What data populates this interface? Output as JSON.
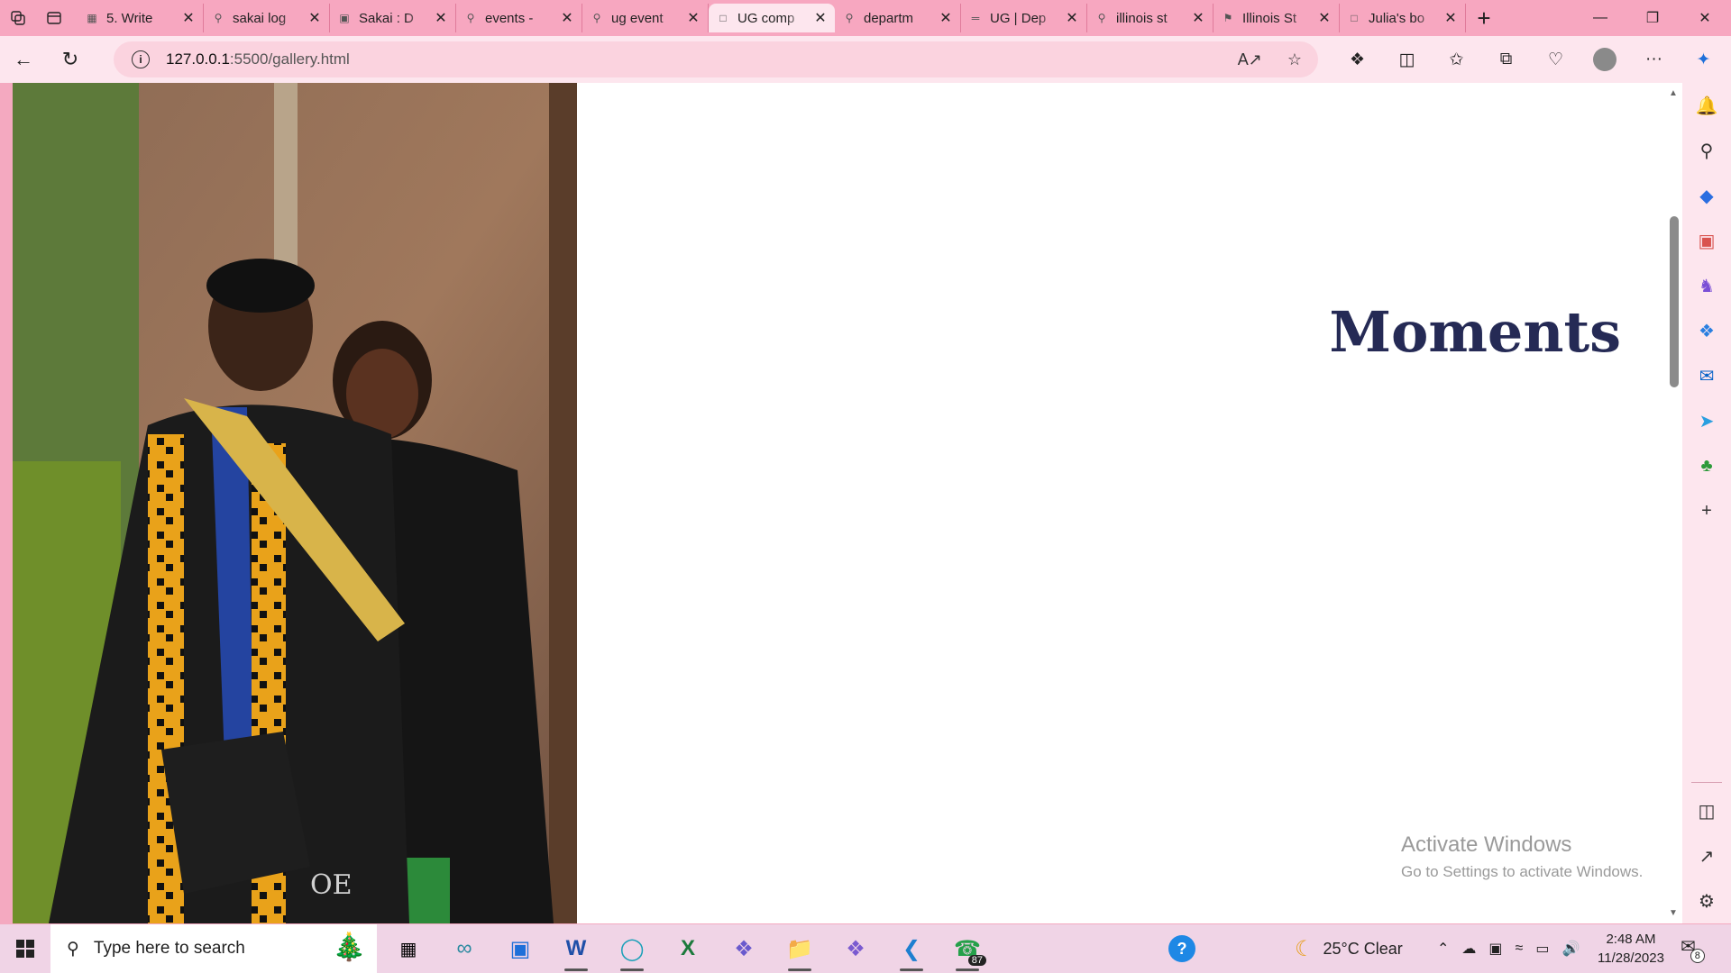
{
  "tabs": [
    {
      "title": "5. Write",
      "icon": "document-icon"
    },
    {
      "title": "sakai log",
      "icon": "search-icon"
    },
    {
      "title": "Sakai : D",
      "icon": "sakai-icon"
    },
    {
      "title": "events -",
      "icon": "search-icon"
    },
    {
      "title": "ug event",
      "icon": "search-icon"
    },
    {
      "title": "UG comp",
      "icon": "page-icon",
      "active": true
    },
    {
      "title": "departm",
      "icon": "search-icon"
    },
    {
      "title": "UG | Dep",
      "icon": "ug-icon"
    },
    {
      "title": "illinois st",
      "icon": "search-icon"
    },
    {
      "title": "Illinois St",
      "icon": "illinois-icon"
    },
    {
      "title": "Julia's bo",
      "icon": "page-icon"
    }
  ],
  "address": {
    "host": "127.0.0.1",
    "path": ":5500/gallery.html"
  },
  "page": {
    "heading": "Moments"
  },
  "watermark": {
    "line1": "Activate Windows",
    "line2": "Go to Settings to activate Windows."
  },
  "taskbar": {
    "search_placeholder": "Type here to search",
    "whatsapp_badge": "87",
    "weather": "25°C  Clear",
    "time": "2:48 AM",
    "date": "11/28/2023",
    "notification_count": "8"
  }
}
